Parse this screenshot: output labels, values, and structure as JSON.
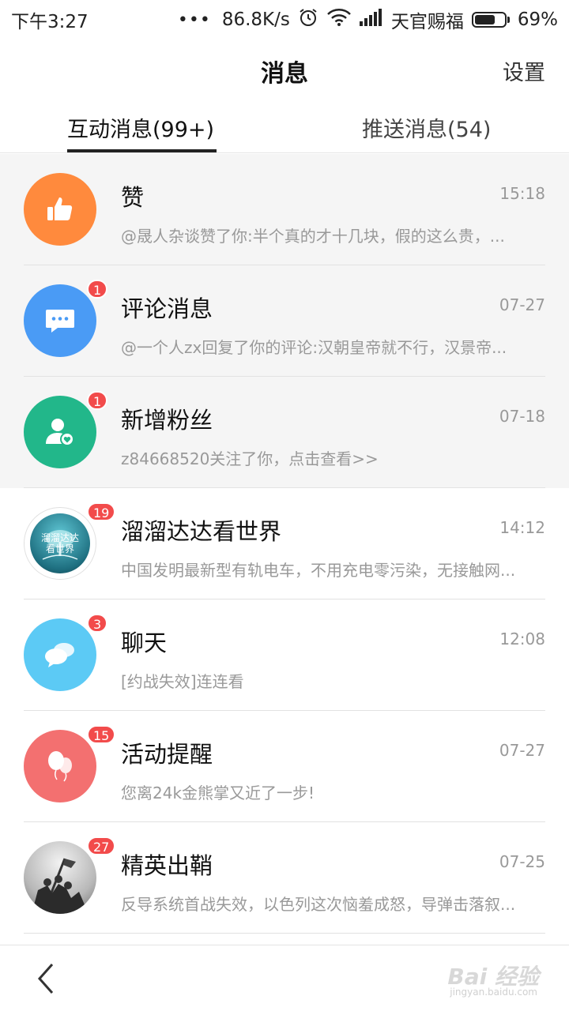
{
  "status_bar": {
    "time": "下午3:27",
    "dots": "•••",
    "net_speed": "86.8K/s",
    "carrier": "天官赐福",
    "battery": "69%",
    "battery_level": 0.69
  },
  "header": {
    "title": "消息",
    "settings_label": "设置"
  },
  "tabs": [
    {
      "label": "互动消息(99+)",
      "active": true
    },
    {
      "label": "推送消息(54)",
      "active": false
    }
  ],
  "items": [
    {
      "name": "赞",
      "time": "15:18",
      "preview": "@晟人杂谈赞了你:半个真的才十几块，假的这么贵，...",
      "badge": "",
      "icon": "thumbs-up-icon",
      "color": "#ff8a3d"
    },
    {
      "name": "评论消息",
      "time": "07-27",
      "preview": "@一个人zx回复了你的评论:汉朝皇帝就不行，汉景帝...",
      "badge": "1",
      "icon": "comment-icon",
      "color": "#4a9bf5"
    },
    {
      "name": "新增粉丝",
      "time": "07-18",
      "preview": "z84668520关注了你，点击查看>>",
      "badge": "1",
      "icon": "new-follower-icon",
      "color": "#22b78a"
    },
    {
      "name": "溜溜达达看世界",
      "time": "14:12",
      "preview": "中国发明最新型有轨电车，不用充电零污染，无接触网...",
      "badge": "19",
      "icon": "tree-avatar-icon",
      "color": "#2a8ca0",
      "avatar_text": "溜溜达达看世界"
    },
    {
      "name": "聊天",
      "time": "12:08",
      "preview": "[约战失效]连连看",
      "badge": "3",
      "icon": "chat-bubbles-icon",
      "color": "#5ccaf5"
    },
    {
      "name": "活动提醒",
      "time": "07-27",
      "preview": "您离24k金熊掌又近了一步!",
      "badge": "15",
      "icon": "balloons-icon",
      "color": "#f37070"
    },
    {
      "name": "精英出鞘",
      "time": "07-25",
      "preview": "反导系统首战失效，以色列这次恼羞成怒，导弹击落叙...",
      "badge": "27",
      "icon": "soldiers-photo-icon",
      "color": "#8a8a8a"
    }
  ],
  "watermark": {
    "text": "Bai 经验",
    "sub": "jingyan.baidu.com"
  }
}
